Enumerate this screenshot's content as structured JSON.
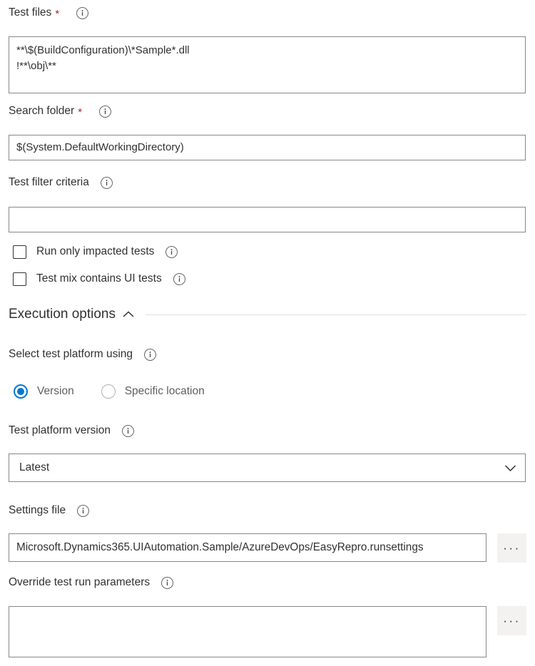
{
  "form": {
    "fields": {
      "test_files": {
        "label": "Test files",
        "required": true,
        "required_marker": "*",
        "value": "**\\$(BuildConfiguration)\\*Sample*.dll\n!**\\obj\\**",
        "info_icon": "info-icon"
      },
      "search_folder": {
        "label": "Search folder",
        "required": true,
        "required_marker": "*",
        "value": "$(System.DefaultWorkingDirectory)",
        "info_icon": "info-icon"
      },
      "test_filter_criteria": {
        "label": "Test filter criteria",
        "required": false,
        "value": "",
        "placeholder": "",
        "info_icon": "info-icon"
      },
      "run_only_impacted_tests": {
        "label": "Run only impacted tests",
        "checked": false,
        "info_icon": "info-icon"
      },
      "test_mix_contains_ui_tests": {
        "label": "Test mix contains UI tests",
        "checked": false,
        "info_icon": "info-icon"
      },
      "select_test_platform_using": {
        "label": "Select test platform using",
        "info_icon": "info-icon",
        "options": [
          {
            "label": "Version",
            "selected": true
          },
          {
            "label": "Specific location",
            "selected": false
          }
        ]
      },
      "test_platform_version": {
        "label": "Test platform version",
        "info_icon": "info-icon",
        "value": "Latest",
        "chevron": "chevron-down-icon"
      },
      "settings_file": {
        "label": "Settings file",
        "info_icon": "info-icon",
        "value": "Microsoft.Dynamics365.UIAutomation.Sample/AzureDevOps/EasyRepro.runsettings",
        "browse_label": "···"
      },
      "override_test_run_parameters": {
        "label": "Override test run parameters",
        "info_icon": "info-icon",
        "value": "",
        "browse_label": "···"
      }
    },
    "sections": {
      "execution_options": {
        "title": "Execution options",
        "expanded": true,
        "chevron": "chevron-up-icon"
      }
    }
  },
  "colors": {
    "accent": "#0078d4",
    "required": "#a4262c",
    "label": "#323130",
    "border": "#8a8886",
    "muted_label": "#605e5c",
    "button_bg": "#f3f2f1",
    "rule": "#e1dfdd"
  }
}
